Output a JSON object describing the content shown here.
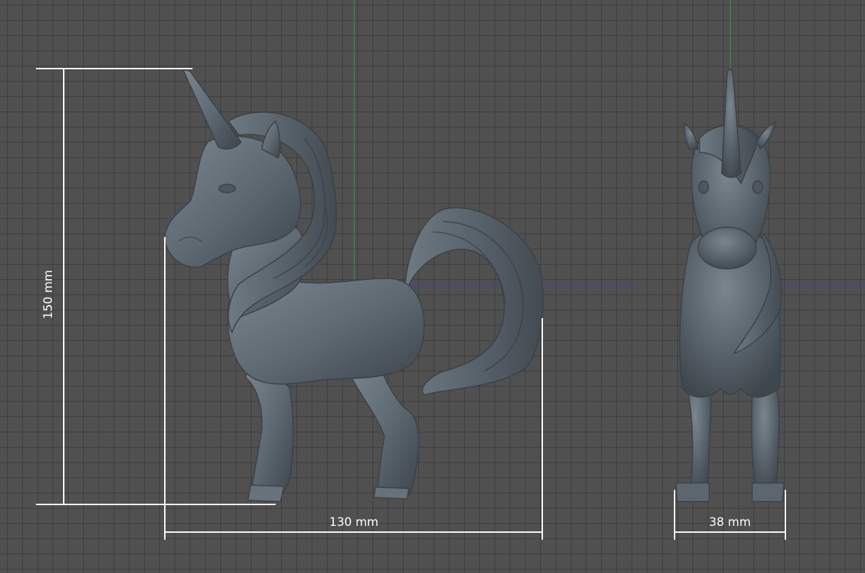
{
  "viewport": {
    "background_color": "#505050",
    "model_color": "#5f6a73",
    "axis_y_color": "#2e9a2e",
    "axis_x_color": "#3a3ad0"
  },
  "dimensions": {
    "height": {
      "value": 150,
      "unit": "mm",
      "label": "150 mm"
    },
    "width": {
      "value": 130,
      "unit": "mm",
      "label": "130 mm"
    },
    "depth": {
      "value": 38,
      "unit": "mm",
      "label": "38 mm"
    }
  },
  "views": [
    "side-view",
    "front-view"
  ]
}
